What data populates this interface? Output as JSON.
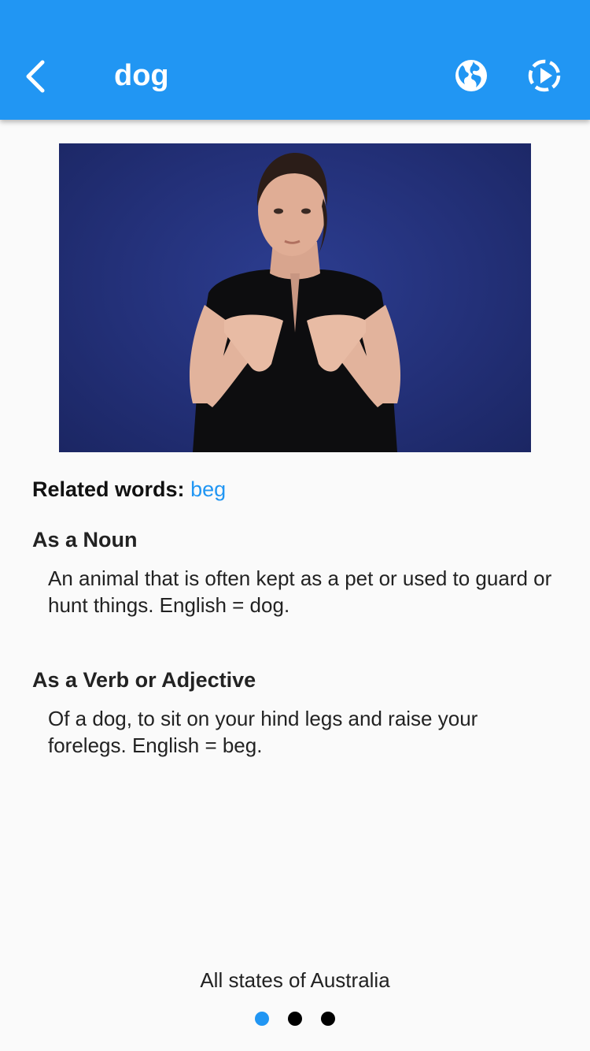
{
  "header": {
    "title": "dog",
    "bg_color": "#2196f3",
    "back_icon": "chevron-left-icon",
    "globe_icon": "globe-icon",
    "play_icon": "play-circle-icon"
  },
  "video": {
    "description_icon": "sign-language-video"
  },
  "related": {
    "label": "Related words:",
    "word": "beg",
    "link_color": "#2196f3"
  },
  "definitions": [
    {
      "heading": "As a Noun",
      "text": "An animal that is often kept as a pet or used to guard or hunt things. English = dog."
    },
    {
      "heading": "As a Verb or Adjective",
      "text": "Of a dog, to sit on your hind legs and raise your forelegs. English = beg."
    }
  ],
  "footer": {
    "region": "All states of Australia"
  },
  "pager": {
    "count": 3,
    "active_index": 0,
    "active_color": "#2196f3",
    "inactive_color": "#000000"
  }
}
